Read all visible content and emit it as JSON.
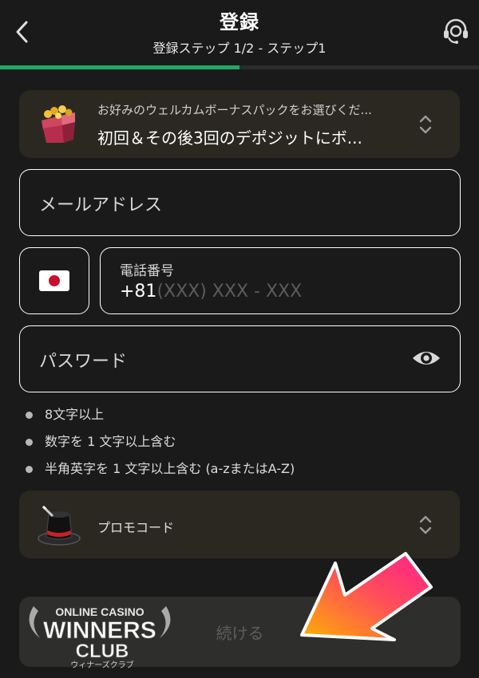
{
  "header": {
    "title": "登録",
    "subtitle": "登録ステップ 1/2 - ステップ1",
    "back_icon": "chevron-left-icon",
    "support_icon": "headset-support-icon"
  },
  "progress": {
    "percent": 50,
    "color": "#1fa866"
  },
  "bonus": {
    "hint": "お好みのウェルカムボーナスパックをお選びくだ...",
    "value": "初回＆その後3回のデポジットにボ...",
    "icon": "gift-box-icon"
  },
  "form": {
    "email_placeholder": "メールアドレス",
    "phone_label": "電話番号",
    "phone_prefix": "+81",
    "phone_placeholder": "(XXX) XXX - XXX",
    "flag": "japan-flag-icon",
    "password_placeholder": "パスワード"
  },
  "password_rules": [
    "8文字以上",
    "数字を 1 文字以上含む",
    "半角英字を 1 文字以上含む (a-zまたはA-Z)"
  ],
  "promo": {
    "label": "プロモコード",
    "icon": "magic-hat-icon"
  },
  "continue_label": "続ける",
  "watermark": {
    "line1": "ONLINE CASINO",
    "line2": "WINNERS",
    "line3": "CLUB",
    "line4": "ウィナーズクラブ"
  },
  "colors": {
    "background": "#1a1a1a",
    "card": "#2b2822",
    "accent": "#1fa866"
  }
}
